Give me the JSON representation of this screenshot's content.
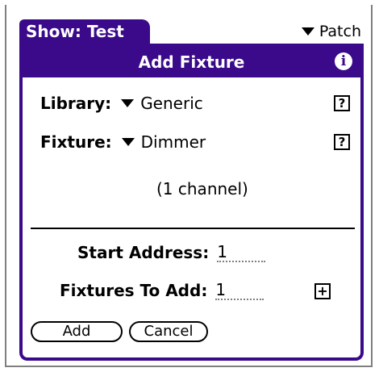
{
  "app": {
    "show_tab": "Show: Test",
    "patch_menu": "Patch"
  },
  "dialog": {
    "title": "Add Fixture",
    "info_icon": "i",
    "library_label": "Library:",
    "library_value": "Generic",
    "fixture_label": "Fixture:",
    "fixture_value": "Dimmer",
    "help_icon": "?",
    "channel_info": "(1 channel)",
    "start_address_label": "Start Address:",
    "start_address_value": "1",
    "fixtures_to_add_label": "Fixtures To Add:",
    "fixtures_to_add_value": "1",
    "plus_icon": "+",
    "add_button": "Add",
    "cancel_button": "Cancel"
  },
  "colors": {
    "accent": "#3a0a8a"
  }
}
